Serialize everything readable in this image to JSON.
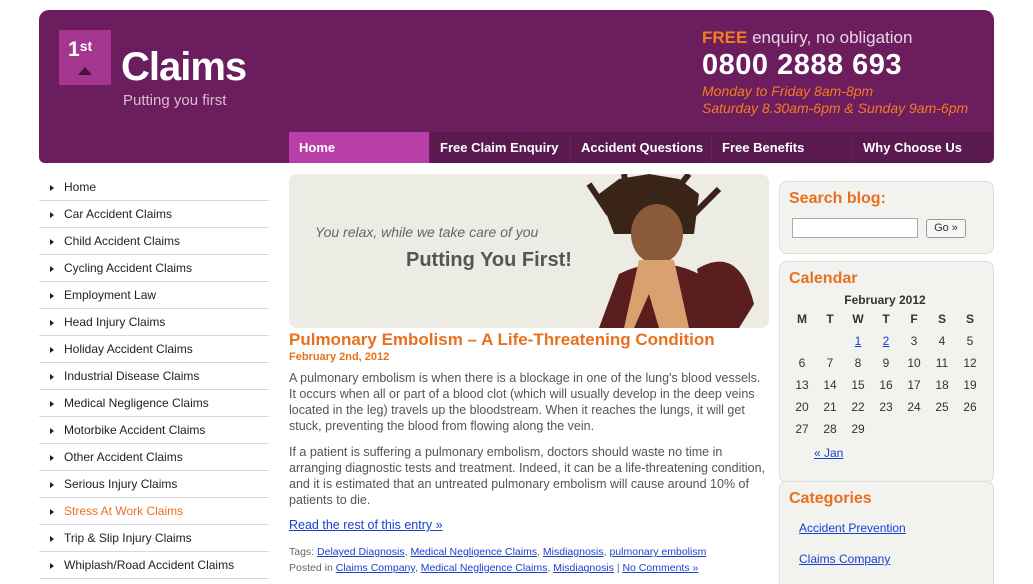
{
  "logo": {
    "num": "1",
    "sup": "st",
    "word": "Claims",
    "tagline": "Putting you first"
  },
  "contact": {
    "free": "FREE",
    "free_rest": "enquiry, no obligation",
    "phone": "0800 2888 693",
    "hours1": "Monday to Friday 8am-8pm",
    "hours2": "Saturday 8.30am-6pm & Sunday 9am-6pm"
  },
  "nav": [
    "Home",
    "Free Claim Enquiry",
    "Accident Questions",
    "Free Benefits",
    "Why Choose Us"
  ],
  "sidebar": [
    "Home",
    "Car Accident Claims",
    "Child Accident Claims",
    "Cycling Accident Claims",
    "Employment Law",
    "Head Injury Claims",
    "Holiday Accident Claims",
    "Industrial Disease Claims",
    "Medical Negligence Claims",
    "Motorbike Accident Claims",
    "Other Accident Claims",
    "Serious Injury Claims",
    "Stress At Work Claims",
    "Trip & Slip Injury Claims",
    "Whiplash/Road Accident Claims"
  ],
  "banner": {
    "relax": "You relax, while we take care of you",
    "putting": "Putting You First!"
  },
  "post": {
    "title": "Pulmonary Embolism – A Life-Threatening Condition",
    "date": "February 2nd, 2012",
    "p1": "A pulmonary embolism is when there is a blockage in one of the lung's blood vessels. It occurs when all or part of a blood clot (which will usually develop in the deep veins located in the leg) travels up the bloodstream. When it reaches the lungs, it will get stuck, preventing the blood from flowing along the vein.",
    "p2": "If a patient is suffering a pulmonary embolism, doctors should waste no time in arranging diagnostic tests and treatment. Indeed, it can be a life-threatening condition, and it is estimated that an untreated pulmonary embolism will cause around 10% of patients to die.",
    "read_more": "Read the rest of this entry »",
    "tags_label": "Tags:",
    "tags": [
      "Delayed Diagnosis",
      "Medical Negligence Claims",
      "Misdiagnosis",
      "pulmonary embolism"
    ],
    "posted_label": "Posted in",
    "posted_in": [
      "Claims Company",
      "Medical Negligence Claims",
      "Misdiagnosis"
    ],
    "comments": "No Comments »"
  },
  "search": {
    "title": "Search blog:",
    "go": "Go »"
  },
  "calendar": {
    "title": "Calendar",
    "caption": "February 2012",
    "days": [
      "M",
      "T",
      "W",
      "T",
      "F",
      "S",
      "S"
    ],
    "weeks": [
      [
        "",
        "",
        "1",
        "2",
        "3",
        "4",
        "5"
      ],
      [
        "6",
        "7",
        "8",
        "9",
        "10",
        "11",
        "12"
      ],
      [
        "13",
        "14",
        "15",
        "16",
        "17",
        "18",
        "19"
      ],
      [
        "20",
        "21",
        "22",
        "23",
        "24",
        "25",
        "26"
      ],
      [
        "27",
        "28",
        "29",
        "",
        "",
        "",
        ""
      ]
    ],
    "linked": [
      "1",
      "2"
    ],
    "prev": "« Jan"
  },
  "categories": {
    "title": "Categories",
    "items": [
      "Accident Prevention",
      "Claims Company"
    ]
  }
}
